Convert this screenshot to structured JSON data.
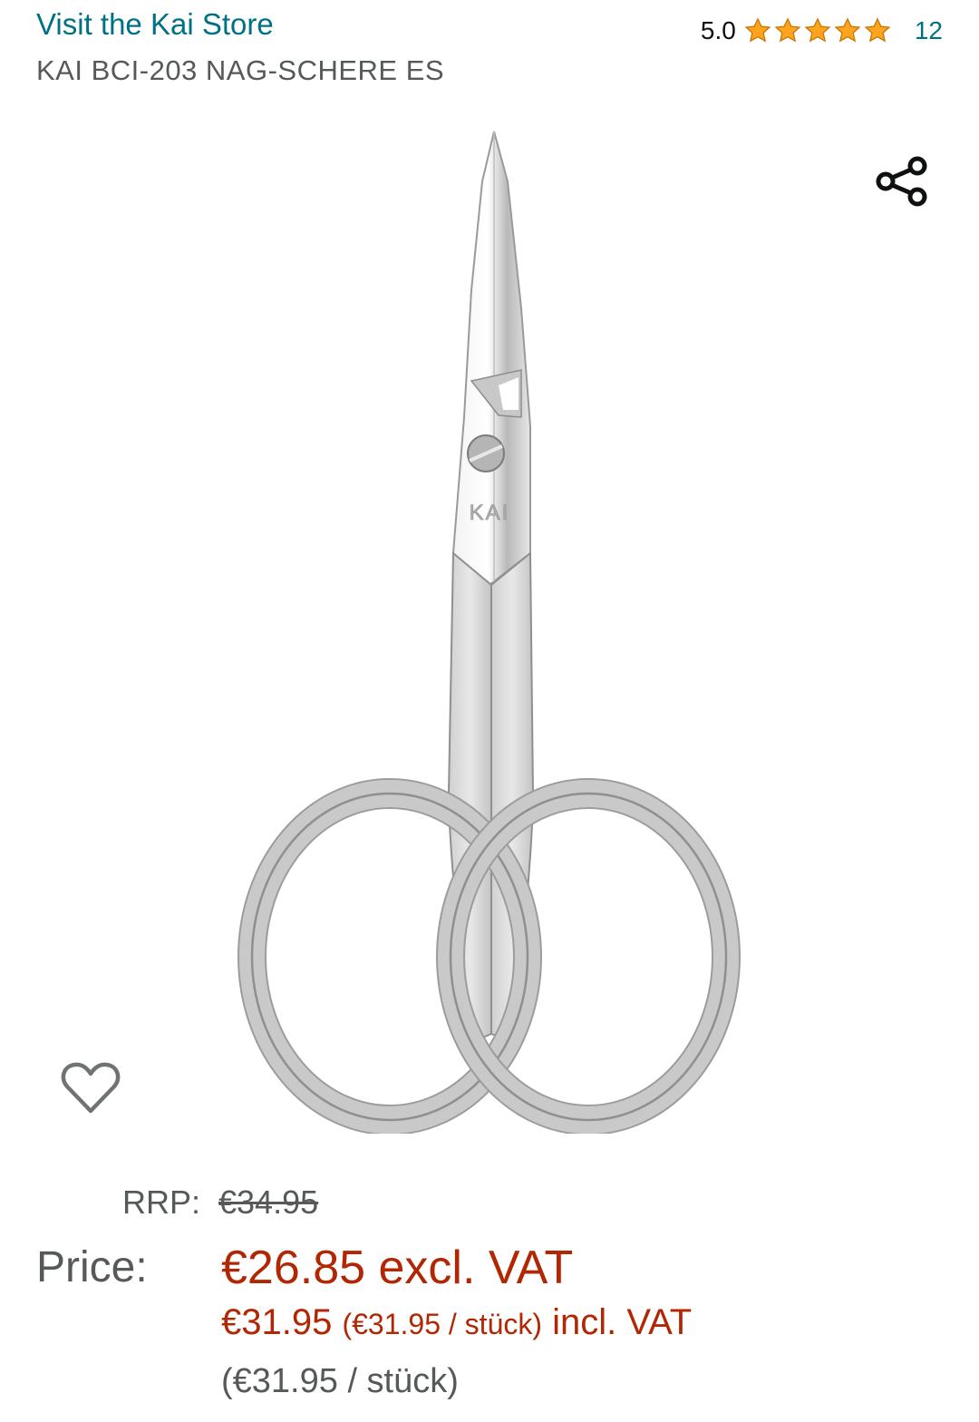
{
  "header": {
    "store_link": "Visit the Kai Store",
    "rating_value": "5.0",
    "rating_count": "12",
    "title": "KAI BCI-203 NAG-SCHERE ES"
  },
  "image": {
    "brand_mark": "KAI",
    "alt": "nail scissors"
  },
  "icons": {
    "share": "share-icon",
    "wishlist": "heart-icon",
    "rating": "star-icon"
  },
  "pricing": {
    "rrp_label": "RRP:",
    "rrp_value": "€34.95",
    "price_label": "Price:",
    "price_excl": "€26.85 excl. VAT",
    "price_incl_amount": "€31.95",
    "price_incl_unit": "(€31.95 / stück)",
    "price_incl_suffix": "incl. VAT",
    "unit_price": "(€31.95 / stück)"
  },
  "colors": {
    "link": "#007185",
    "price": "#b12704",
    "star": "#ffa41c",
    "muted": "#565959"
  }
}
